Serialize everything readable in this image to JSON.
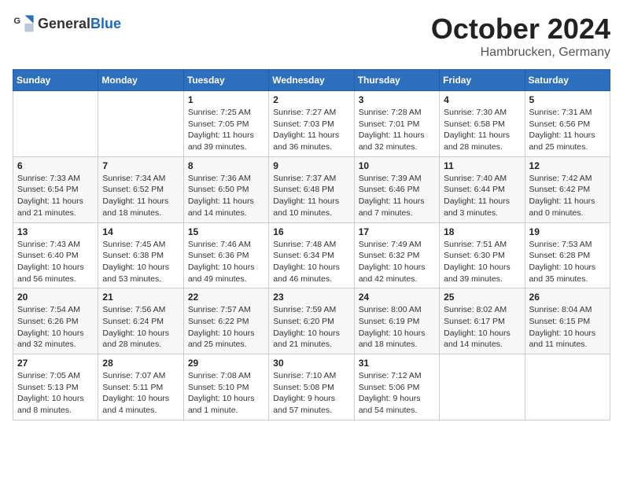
{
  "header": {
    "logo_general": "General",
    "logo_blue": "Blue",
    "month": "October 2024",
    "location": "Hambrucken, Germany"
  },
  "weekdays": [
    "Sunday",
    "Monday",
    "Tuesday",
    "Wednesday",
    "Thursday",
    "Friday",
    "Saturday"
  ],
  "weeks": [
    [
      {
        "day": "",
        "info": ""
      },
      {
        "day": "",
        "info": ""
      },
      {
        "day": "1",
        "info": "Sunrise: 7:25 AM\nSunset: 7:05 PM\nDaylight: 11 hours and 39 minutes."
      },
      {
        "day": "2",
        "info": "Sunrise: 7:27 AM\nSunset: 7:03 PM\nDaylight: 11 hours and 36 minutes."
      },
      {
        "day": "3",
        "info": "Sunrise: 7:28 AM\nSunset: 7:01 PM\nDaylight: 11 hours and 32 minutes."
      },
      {
        "day": "4",
        "info": "Sunrise: 7:30 AM\nSunset: 6:58 PM\nDaylight: 11 hours and 28 minutes."
      },
      {
        "day": "5",
        "info": "Sunrise: 7:31 AM\nSunset: 6:56 PM\nDaylight: 11 hours and 25 minutes."
      }
    ],
    [
      {
        "day": "6",
        "info": "Sunrise: 7:33 AM\nSunset: 6:54 PM\nDaylight: 11 hours and 21 minutes."
      },
      {
        "day": "7",
        "info": "Sunrise: 7:34 AM\nSunset: 6:52 PM\nDaylight: 11 hours and 18 minutes."
      },
      {
        "day": "8",
        "info": "Sunrise: 7:36 AM\nSunset: 6:50 PM\nDaylight: 11 hours and 14 minutes."
      },
      {
        "day": "9",
        "info": "Sunrise: 7:37 AM\nSunset: 6:48 PM\nDaylight: 11 hours and 10 minutes."
      },
      {
        "day": "10",
        "info": "Sunrise: 7:39 AM\nSunset: 6:46 PM\nDaylight: 11 hours and 7 minutes."
      },
      {
        "day": "11",
        "info": "Sunrise: 7:40 AM\nSunset: 6:44 PM\nDaylight: 11 hours and 3 minutes."
      },
      {
        "day": "12",
        "info": "Sunrise: 7:42 AM\nSunset: 6:42 PM\nDaylight: 11 hours and 0 minutes."
      }
    ],
    [
      {
        "day": "13",
        "info": "Sunrise: 7:43 AM\nSunset: 6:40 PM\nDaylight: 10 hours and 56 minutes."
      },
      {
        "day": "14",
        "info": "Sunrise: 7:45 AM\nSunset: 6:38 PM\nDaylight: 10 hours and 53 minutes."
      },
      {
        "day": "15",
        "info": "Sunrise: 7:46 AM\nSunset: 6:36 PM\nDaylight: 10 hours and 49 minutes."
      },
      {
        "day": "16",
        "info": "Sunrise: 7:48 AM\nSunset: 6:34 PM\nDaylight: 10 hours and 46 minutes."
      },
      {
        "day": "17",
        "info": "Sunrise: 7:49 AM\nSunset: 6:32 PM\nDaylight: 10 hours and 42 minutes."
      },
      {
        "day": "18",
        "info": "Sunrise: 7:51 AM\nSunset: 6:30 PM\nDaylight: 10 hours and 39 minutes."
      },
      {
        "day": "19",
        "info": "Sunrise: 7:53 AM\nSunset: 6:28 PM\nDaylight: 10 hours and 35 minutes."
      }
    ],
    [
      {
        "day": "20",
        "info": "Sunrise: 7:54 AM\nSunset: 6:26 PM\nDaylight: 10 hours and 32 minutes."
      },
      {
        "day": "21",
        "info": "Sunrise: 7:56 AM\nSunset: 6:24 PM\nDaylight: 10 hours and 28 minutes."
      },
      {
        "day": "22",
        "info": "Sunrise: 7:57 AM\nSunset: 6:22 PM\nDaylight: 10 hours and 25 minutes."
      },
      {
        "day": "23",
        "info": "Sunrise: 7:59 AM\nSunset: 6:20 PM\nDaylight: 10 hours and 21 minutes."
      },
      {
        "day": "24",
        "info": "Sunrise: 8:00 AM\nSunset: 6:19 PM\nDaylight: 10 hours and 18 minutes."
      },
      {
        "day": "25",
        "info": "Sunrise: 8:02 AM\nSunset: 6:17 PM\nDaylight: 10 hours and 14 minutes."
      },
      {
        "day": "26",
        "info": "Sunrise: 8:04 AM\nSunset: 6:15 PM\nDaylight: 10 hours and 11 minutes."
      }
    ],
    [
      {
        "day": "27",
        "info": "Sunrise: 7:05 AM\nSunset: 5:13 PM\nDaylight: 10 hours and 8 minutes."
      },
      {
        "day": "28",
        "info": "Sunrise: 7:07 AM\nSunset: 5:11 PM\nDaylight: 10 hours and 4 minutes."
      },
      {
        "day": "29",
        "info": "Sunrise: 7:08 AM\nSunset: 5:10 PM\nDaylight: 10 hours and 1 minute."
      },
      {
        "day": "30",
        "info": "Sunrise: 7:10 AM\nSunset: 5:08 PM\nDaylight: 9 hours and 57 minutes."
      },
      {
        "day": "31",
        "info": "Sunrise: 7:12 AM\nSunset: 5:06 PM\nDaylight: 9 hours and 54 minutes."
      },
      {
        "day": "",
        "info": ""
      },
      {
        "day": "",
        "info": ""
      }
    ]
  ]
}
